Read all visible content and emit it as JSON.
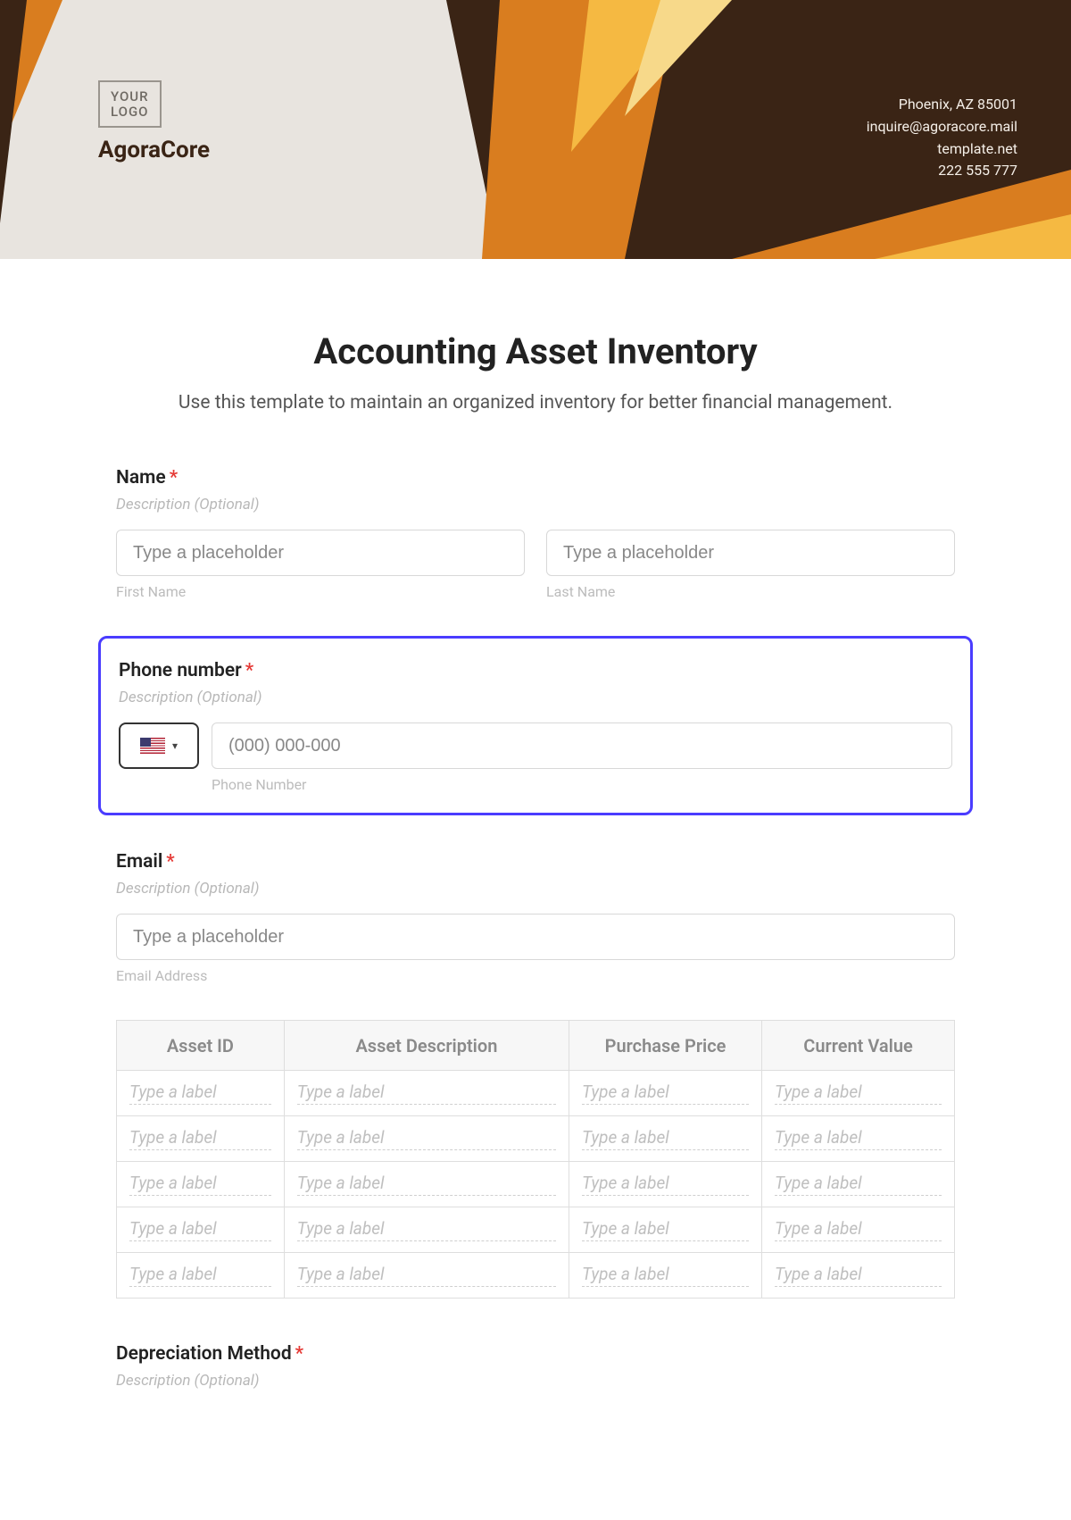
{
  "header": {
    "logo_line1": "YOUR",
    "logo_line2": "LOGO",
    "brand": "AgoraCore",
    "contact": {
      "line1": "Phoenix, AZ 85001",
      "line2": "inquire@agoracore.mail",
      "line3": "template.net",
      "line4": "222 555 777"
    }
  },
  "title": "Accounting Asset Inventory",
  "subtitle": "Use this template to maintain an organized inventory for better financial management.",
  "name": {
    "label": "Name",
    "required": "*",
    "desc": "Description (Optional)",
    "first_ph": "Type a placeholder",
    "first_sub": "First Name",
    "last_ph": "Type a placeholder",
    "last_sub": "Last Name"
  },
  "phone": {
    "label": "Phone number",
    "required": "*",
    "desc": "Description (Optional)",
    "ph": "(000) 000-000",
    "sub": "Phone Number"
  },
  "email": {
    "label": "Email",
    "required": "*",
    "desc": "Description (Optional)",
    "ph": "Type a placeholder",
    "sub": "Email Address"
  },
  "table": {
    "headers": [
      "Asset ID",
      "Asset Description",
      "Purchase Price",
      "Current Value"
    ],
    "cell_ph": "Type a label",
    "rows": 5,
    "cols": 4
  },
  "depreciation": {
    "label": "Depreciation Method",
    "required": "*",
    "desc": "Description (Optional)"
  }
}
